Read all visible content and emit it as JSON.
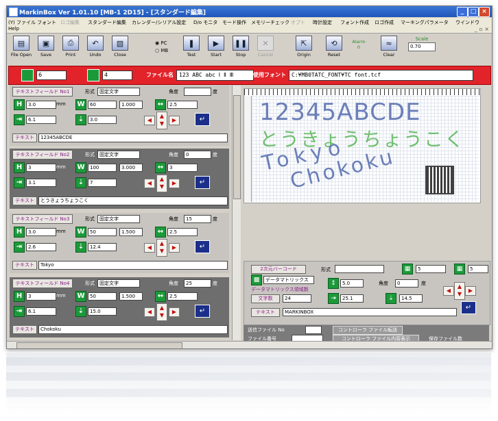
{
  "window": {
    "title": "MarkinBox  Ver 1.01.10    [MB-1 2D15] - [スタンダード編集]",
    "controls": [
      "_",
      "□",
      "×"
    ]
  },
  "menu": {
    "items": [
      {
        "label": "(Y) ファイル",
        "enabled": true
      },
      {
        "label": "フォント",
        "enabled": true
      },
      {
        "label": "ロゴ編集",
        "enabled": false
      },
      {
        "label": "スタンダード編集",
        "enabled": true
      },
      {
        "label": "カレンダー/シリアル設定",
        "enabled": true
      },
      {
        "label": "D/o モニタ",
        "enabled": true
      },
      {
        "label": "モード操作",
        "enabled": true
      },
      {
        "label": "メモリーチェック",
        "enabled": true
      },
      {
        "label": "オプト",
        "enabled": false
      },
      {
        "label": "時計設定",
        "enabled": true
      },
      {
        "label": "フォント作成",
        "enabled": true
      },
      {
        "label": "ロゴ作成",
        "enabled": true
      },
      {
        "label": "マーキングパラメータ",
        "enabled": true
      },
      {
        "label": "ウインドウ",
        "enabled": true
      }
    ],
    "help": "Help",
    "mdi_controls": "_ ▫ ×"
  },
  "toolbar": {
    "buttons": [
      {
        "label": "File Open",
        "icon": "▤"
      },
      {
        "label": "Save",
        "icon": "▣"
      },
      {
        "label": "Print",
        "icon": "⎙"
      },
      {
        "label": "Undo",
        "icon": "↶"
      },
      {
        "label": "Close",
        "icon": "▧"
      },
      {
        "label": "Test",
        "icon": "❚"
      },
      {
        "label": "Start",
        "icon": "▶"
      },
      {
        "label": "Stop",
        "icon": "❚❚"
      },
      {
        "label": "Cancel",
        "icon": "✕",
        "enabled": false
      },
      {
        "label": "Origin",
        "icon": "⇱"
      },
      {
        "label": "Reset",
        "icon": "⟲"
      },
      {
        "label": "Clear",
        "icon": "≈"
      }
    ],
    "radio_pc": "PC",
    "radio_mb": "MB",
    "alarm_label": "Alarm",
    "alarm_value": "0",
    "scale_label": "Scale",
    "scale_value": "0.70"
  },
  "redbar": {
    "combo1": "6",
    "combo2": "4",
    "filename_label": "ファイル名",
    "filename_value": "123 ABC abc Ⅰ Ⅱ Ⅲ",
    "font_label": "使用フォント",
    "font_value": "C:¥MB0TATC_FONT¥TC font.tcf",
    "accent": "#e2232a"
  },
  "text_fields": [
    {
      "header": "テキストフィールド No1",
      "shape_label": "形式",
      "shape_value": "固定文字",
      "angle_label": "角度",
      "angle_value": "",
      "unit_deg": "度",
      "h_value": "3.0",
      "w_value": "60",
      "ratio": "1.000",
      "pitch": "2.5",
      "x_value": "6.1",
      "y_value": "3.0",
      "text_label": "テキスト",
      "text_value": "12345ABCDE",
      "theme": "light"
    },
    {
      "header": "テキストフィールド No2",
      "shape_label": "形式",
      "shape_value": "固定文字",
      "angle_label": "角度",
      "angle_value": "0",
      "unit_deg": "度",
      "h_value": "3",
      "w_value": "100",
      "ratio": "3.000",
      "pitch": "3",
      "x_value": "3.1",
      "y_value": "7",
      "text_label": "テキスト",
      "text_value": "とうきょうちょうこく",
      "theme": "dark"
    },
    {
      "header": "テキストフィールド No3",
      "shape_label": "形式",
      "shape_value": "固定文字",
      "angle_label": "角度",
      "angle_value": "15",
      "unit_deg": "度",
      "h_value": "3.0",
      "w_value": "50",
      "ratio": "1.500",
      "pitch": "2.5",
      "x_value": "2.6",
      "y_value": "12.4",
      "text_label": "テキスト",
      "text_value": "Tokyo",
      "theme": "light"
    },
    {
      "header": "テキストフィールド No4",
      "shape_label": "形式",
      "shape_value": "固定文字",
      "angle_label": "角度",
      "angle_value": "25",
      "unit_deg": "度",
      "h_value": "3",
      "w_value": "50",
      "ratio": "1.500",
      "pitch": "2.5",
      "x_value": "6.1",
      "y_value": "15.0",
      "text_label": "テキスト",
      "text_value": "Chokoku",
      "theme": "dark"
    }
  ],
  "units": {
    "mm": "mm"
  },
  "canvas": {
    "line1": "12345ABCDE",
    "line2": "とうきょうちょうこく",
    "line3": "Tokyo",
    "line4": "Chokoku",
    "ruler_marks": [
      "1",
      "2",
      "3",
      "4",
      "5",
      "6",
      "7",
      "8",
      "9",
      "10",
      "11",
      "12",
      "13"
    ]
  },
  "barcode_panel": {
    "header": "2次元バーコード",
    "shape_label": "形式",
    "type_value": "データマトリックス",
    "sub_label": "データマトリックス領域数",
    "size_label": "文字数",
    "size_value": "24",
    "h_value": "5.0",
    "angle_label": "角度",
    "angle_value": "0",
    "unit_deg": "度",
    "x_value": "25.1",
    "y_value": "14.5",
    "combo_a": "5",
    "combo_b": "5",
    "text_label": "テキスト",
    "text_value": "MARKINBOX"
  },
  "bottom": {
    "send_label": "送信ファイル No",
    "controller_send": "コントローラ ファイル転送",
    "file_label": "ファイル番号",
    "controller_read": "コントローラ ファイル内容表示",
    "save_file": "保存ファイル数"
  }
}
